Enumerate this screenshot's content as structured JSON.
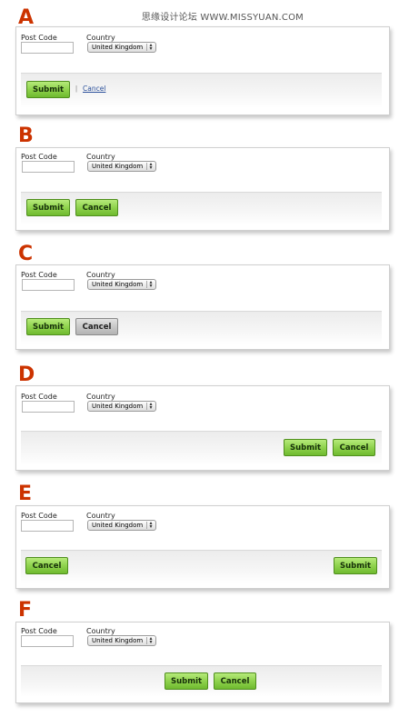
{
  "watermark": "思缘设计论坛 WWW.MISSYUAN.COM",
  "labels": {
    "post_code": "Post Code",
    "country": "Country",
    "country_value": "United Kingdom",
    "submit": "Submit",
    "cancel": "Cancel",
    "separator": "|"
  },
  "variants": [
    "A",
    "B",
    "C",
    "D",
    "E",
    "F"
  ],
  "colors": {
    "letter": "#cc3300",
    "primary_button": "#8fd24d",
    "secondary_button": "#c8c8c8",
    "link": "#2a4f9a"
  }
}
